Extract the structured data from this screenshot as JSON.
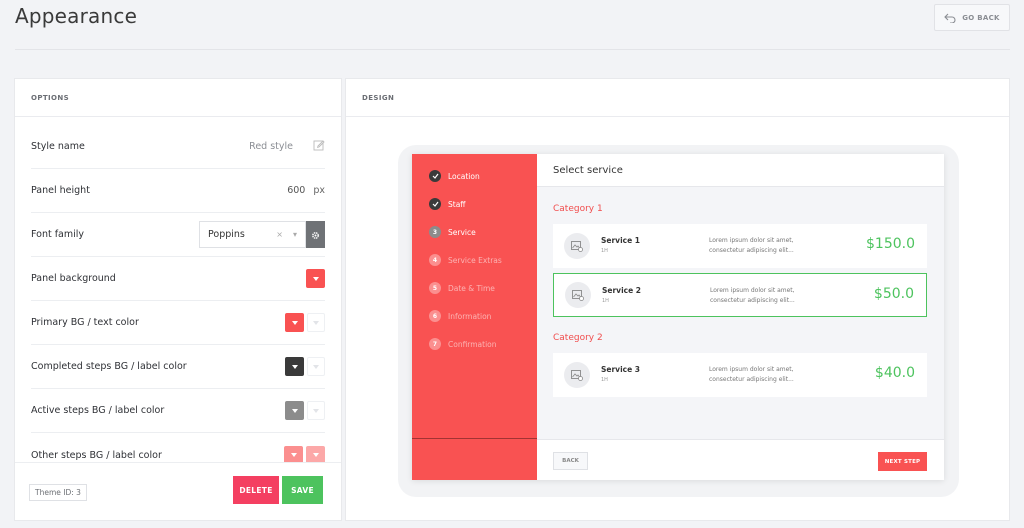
{
  "header": {
    "title": "Appearance",
    "go_back_label": "GO BACK"
  },
  "options": {
    "header": "OPTIONS",
    "rows": [
      {
        "label": "Style name",
        "value": "Red style"
      },
      {
        "label": "Panel height",
        "value": "600",
        "unit": "px"
      },
      {
        "label": "Font family",
        "value": "Poppins"
      },
      {
        "label": "Panel background"
      },
      {
        "label": "Primary BG / text color"
      },
      {
        "label": "Completed steps BG / label color"
      },
      {
        "label": "Active steps BG / label color"
      },
      {
        "label": "Other steps BG / label color"
      }
    ],
    "theme_id": "Theme ID: 3",
    "delete_label": "DELETE",
    "save_label": "SAVE"
  },
  "colors": {
    "panel_background": "#f95252",
    "primary": "#f95252",
    "completed": "#3a3a3a",
    "active": "#8c8c8c",
    "other_bg": "#fb8f8f",
    "other_label": "#fca8a8",
    "price": "#4dc35e",
    "delete": "#f43f61",
    "save": "#4dc35e"
  },
  "design": {
    "header": "DESIGN",
    "steps": [
      {
        "num": "",
        "label": "Location",
        "state": "completed"
      },
      {
        "num": "",
        "label": "Staff",
        "state": "completed"
      },
      {
        "num": "3",
        "label": "Service",
        "state": "active"
      },
      {
        "num": "4",
        "label": "Service Extras",
        "state": "other"
      },
      {
        "num": "5",
        "label": "Date & Time",
        "state": "other"
      },
      {
        "num": "6",
        "label": "Information",
        "state": "other"
      },
      {
        "num": "7",
        "label": "Confirmation",
        "state": "other"
      }
    ],
    "main_title": "Select service",
    "categories": [
      {
        "name": "Category 1",
        "services": [
          {
            "name": "Service 1",
            "duration": "1H",
            "desc": "Lorem ipsum dolor sit amet, consectetur adipiscing elit...",
            "price": "$150.0",
            "selected": false
          },
          {
            "name": "Service 2",
            "duration": "1H",
            "desc": "Lorem ipsum dolor sit amet, consectetur adipiscing elit...",
            "price": "$50.0",
            "selected": true
          }
        ]
      },
      {
        "name": "Category 2",
        "services": [
          {
            "name": "Service 3",
            "duration": "1H",
            "desc": "Lorem ipsum dolor sit amet, consectetur adipiscing elit...",
            "price": "$40.0",
            "selected": false
          }
        ]
      }
    ],
    "back_label": "BACK",
    "next_label": "NEXT STEP"
  }
}
